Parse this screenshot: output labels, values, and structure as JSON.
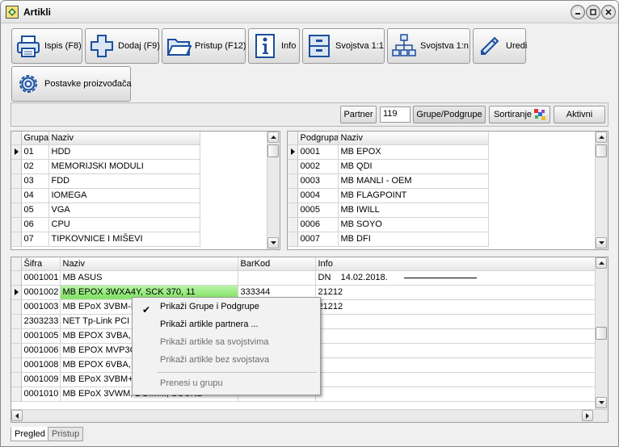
{
  "window": {
    "title": "Artikli"
  },
  "toolbar": {
    "ispis": "Ispis (F8)",
    "dodaj": "Dodaj (F9)",
    "pristup": "Pristup (F12)",
    "info": "Info",
    "svojstva11": "Svojstva 1:1",
    "svojstva1n": "Svojstva 1:n",
    "uredi": "Uredi",
    "postavke": "Postavke proizvođača"
  },
  "filterbar": {
    "partner_label": "Partner",
    "partner_value": "119",
    "grupe_label": "Grupe/Podgrupe",
    "sortiranje_label": "Sortiranje",
    "aktivni_label": "Aktivni"
  },
  "groups": {
    "headers": [
      "Grupa",
      "Naziv"
    ],
    "rows": [
      [
        "01",
        "HDD"
      ],
      [
        "02",
        "MEMORIJSKI MODULI"
      ],
      [
        "03",
        "FDD"
      ],
      [
        "04",
        "IOMEGA"
      ],
      [
        "05",
        "VGA"
      ],
      [
        "06",
        "CPU"
      ],
      [
        "07",
        "TIPKOVNICE I MIŠEVI"
      ]
    ]
  },
  "subgroups": {
    "headers": [
      "Podgrupa",
      "Naziv"
    ],
    "rows": [
      [
        "0001",
        "MB EPOX"
      ],
      [
        "0002",
        "MB QDI"
      ],
      [
        "0003",
        "MB MANLI - OEM"
      ],
      [
        "0004",
        "MB FLAGPOINT"
      ],
      [
        "0005",
        "MB IWILL"
      ],
      [
        "0006",
        "MB SOYO"
      ],
      [
        "0007",
        "MB DFI"
      ]
    ]
  },
  "articles": {
    "headers": [
      "Šifra",
      "Naziv",
      "BarKod",
      "Info"
    ],
    "rows": [
      [
        "0001001",
        "MB ASUS",
        "",
        "DN    14.02.2018."
      ],
      [
        "0001002",
        "MB EPOX 3WXA4Y, SCK 370, 11",
        "333344",
        "21212"
      ],
      [
        "0001003",
        "MB EPoX 3VBM-L",
        "",
        "21212"
      ],
      [
        "2303233",
        "NET Tp-Link PCI 1",
        "",
        ""
      ],
      [
        "0001005",
        "MB EPOX 3VBA, S",
        "",
        ""
      ],
      [
        "0001006",
        "MB EPOX MVP3G",
        "",
        ""
      ],
      [
        "0001008",
        "MB EPOX 6VBA, S",
        "",
        ""
      ],
      [
        "0001009",
        "MB EPoX 3VBM+,",
        "",
        ""
      ],
      [
        "0001010",
        "MB EPoX 3VWM, 2 DIMM, SOUND",
        "",
        ""
      ]
    ]
  },
  "context_menu": {
    "items": [
      {
        "label": "Prikaži Grupe i Podgrupe",
        "checked": true
      },
      {
        "label": "Prikaži artikle partnera ..."
      },
      {
        "label": "Prikaži artikle sa svojstvima"
      },
      {
        "label": "Prikaži artikle bez svojstava"
      },
      {
        "label": "Prenesi u grupu"
      }
    ]
  },
  "tabs": [
    "Pregled",
    "Pristup"
  ],
  "colors": {
    "highlight": "#8ee870",
    "icon_blue": "#1a4f9c"
  }
}
